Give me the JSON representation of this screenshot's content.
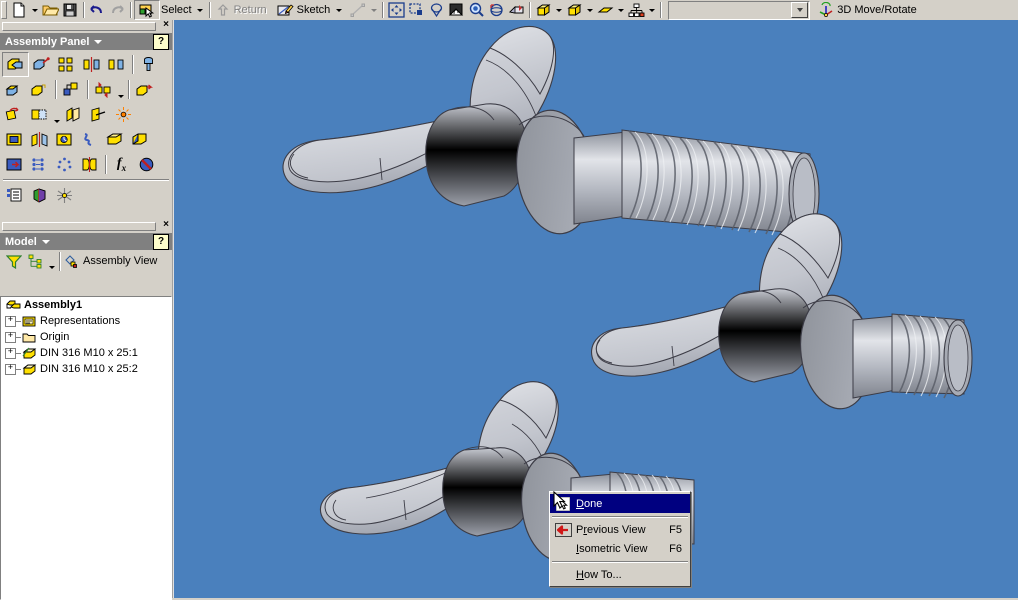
{
  "toolbar": {
    "buttons": [
      {
        "name": "new-file",
        "icon": "new-document-icon",
        "label": ""
      },
      {
        "name": "open-file",
        "icon": "open-folder-icon",
        "label": ""
      },
      {
        "name": "save-file",
        "icon": "floppy-disk-icon",
        "label": ""
      },
      {
        "name": "undo",
        "icon": "undo-arrow-icon",
        "label": ""
      },
      {
        "name": "redo",
        "icon": "redo-arrow-icon",
        "label": ""
      }
    ],
    "select_label": "Select",
    "return_label": "Return",
    "sketch_label": "Sketch",
    "mode_label": "3D Move/Rotate",
    "combo_value": ""
  },
  "assembly_panel": {
    "title": "Assembly Panel",
    "help_label": "?",
    "close_label": "×",
    "row1": [
      {
        "name": "place-component-icon"
      },
      {
        "name": "create-component-icon"
      },
      {
        "name": "pattern-component-icon"
      },
      {
        "name": "mirror-component-icon"
      },
      {
        "name": "copy-component-icon"
      },
      {
        "name": "replace-component-icon"
      }
    ],
    "row2": [
      {
        "name": "constraint-icon"
      },
      {
        "name": "joint-icon"
      },
      {
        "name": "assemble-icon"
      },
      {
        "name": "show-relationships-icon"
      },
      {
        "name": "move-component-icon"
      }
    ],
    "row3": [
      {
        "name": "rotate-component-icon"
      },
      {
        "name": "section-view-icon"
      },
      {
        "name": "work-plane-icon"
      },
      {
        "name": "work-axis-icon"
      },
      {
        "name": "work-point-icon"
      }
    ],
    "row4": [
      {
        "name": "create-ipart-icon"
      },
      {
        "name": "mirror-assembly-icon"
      },
      {
        "name": "bom-icon"
      },
      {
        "name": "weld-symbol-icon"
      },
      {
        "name": "bolted-connection-icon"
      },
      {
        "name": "frame-generator-icon"
      }
    ],
    "row5": [
      {
        "name": "parameters-icon"
      },
      {
        "name": "design-assistant-icon"
      },
      {
        "name": "analysis-icon"
      },
      {
        "name": "interference-icon"
      },
      {
        "name": "fx-parameters-icon"
      },
      {
        "name": "suppress-icon"
      }
    ],
    "row6": [
      {
        "name": "bill-of-materials-icon"
      },
      {
        "name": "drive-constraint-icon"
      },
      {
        "name": "dynamic-simulation-icon"
      }
    ]
  },
  "model_panel": {
    "title": "Model",
    "help_label": "?",
    "close_label": "×",
    "filter_icon": "funnel-icon",
    "group_icon": "tree-group-icon",
    "view_label": "Assembly View"
  },
  "tree": {
    "nodes": [
      {
        "label": "Assembly1",
        "icon": "assembly-icon",
        "level": 0,
        "expandable": false,
        "bold": true
      },
      {
        "label": "Representations",
        "icon": "representations-folder-icon",
        "level": 1,
        "expandable": true,
        "bold": false
      },
      {
        "label": "Origin",
        "icon": "origin-folder-icon",
        "level": 1,
        "expandable": true,
        "bold": false
      },
      {
        "label": "DIN 316  M10 x 25:1",
        "icon": "part-unconstrained-icon",
        "level": 1,
        "expandable": true,
        "bold": false
      },
      {
        "label": "DIN 316  M10 x 25:2",
        "icon": "part-icon",
        "level": 1,
        "expandable": true,
        "bold": false
      }
    ]
  },
  "context_menu": {
    "items": [
      {
        "label": "Done",
        "accel": "",
        "icon": "arrow-cursor-icon",
        "highlighted": true,
        "underline_index": 0
      },
      {
        "separator": true
      },
      {
        "label": "Previous View",
        "accel": "F5",
        "icon": "previous-view-icon",
        "highlighted": false,
        "underline_index": 1
      },
      {
        "label": "Isometric View",
        "accel": "F6",
        "icon": "",
        "highlighted": false,
        "underline_index": 0
      },
      {
        "separator": true
      },
      {
        "label": "How To...",
        "accel": "",
        "icon": "",
        "highlighted": false,
        "underline_index": 0
      }
    ]
  },
  "viewport": {
    "background_color": "#4a80bd",
    "model_description": "Two DIN 316 M10 x 25 wing bolts shaded gray in isometric assembly view",
    "part_fill": "#b9bcc4",
    "part_edge": "#3c3c46"
  },
  "colors": {
    "face": "#d4d0c8",
    "shadow": "#808080",
    "titlebar": "#808080",
    "highlight": "#000080",
    "viewport": "#4a80bd"
  }
}
